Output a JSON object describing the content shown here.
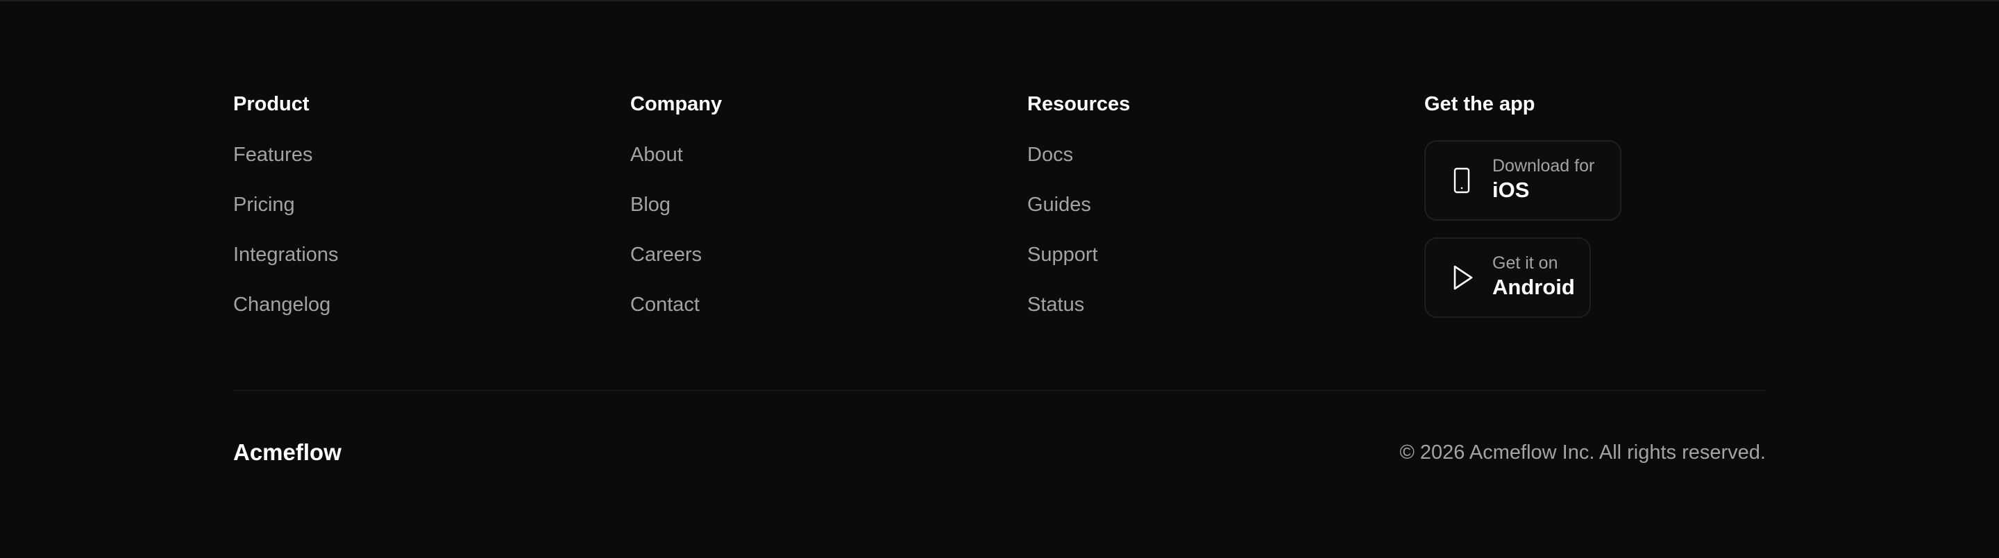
{
  "columns": {
    "product": {
      "title": "Product",
      "links": [
        "Features",
        "Pricing",
        "Integrations",
        "Changelog"
      ]
    },
    "company": {
      "title": "Company",
      "links": [
        "About",
        "Blog",
        "Careers",
        "Contact"
      ]
    },
    "resources": {
      "title": "Resources",
      "links": [
        "Docs",
        "Guides",
        "Support",
        "Status"
      ]
    },
    "app": {
      "title": "Get the app",
      "ios": {
        "small": "Download for",
        "big": "iOS",
        "icon": "phone-icon"
      },
      "android": {
        "small": "Get it on",
        "big": "Android",
        "icon": "play-icon"
      }
    }
  },
  "footer": {
    "brand": "Acmeflow",
    "copyright": "© 2026 Acmeflow Inc. All rights reserved."
  },
  "colors": {
    "background": "#0b0b0b",
    "text_primary": "#ffffff",
    "text_muted": "#a3a3a3",
    "border": "#1f1f1f"
  }
}
